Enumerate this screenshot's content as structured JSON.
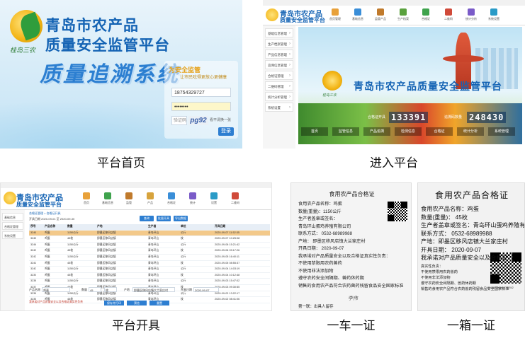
{
  "captions": {
    "home": "平台首页",
    "enter": "进入平台",
    "issue": "平台开具",
    "truck": "一车一证",
    "box": "一箱一证"
  },
  "login": {
    "title_line1": "青岛市农产品",
    "title_line2": "质量安全监管平台",
    "system_name": "质量追溯系统",
    "brand": "桂岛三农",
    "box_heading": "为安全监管",
    "box_sub": "让市民吃得更放心更健康",
    "username": "18754329727",
    "password": "••••••••",
    "captcha_placeholder": "验证码",
    "captcha_code": "pg92",
    "captcha_tip": "看不清换一张",
    "login_button": "登录"
  },
  "platform": {
    "title_line1": "青岛市农产品",
    "title_line2": "质量安全监管平台",
    "banner_title": "青岛市农产品质量安全监管平台",
    "brand": "桂岛三农",
    "nav": [
      "首页管理",
      "基础信息",
      "监管产品",
      "生产档案",
      "合格证",
      "二维码",
      "统计分析",
      "系统设置"
    ],
    "sidebar": [
      "基础信息管理",
      "生产档案管理",
      "产品信息管理",
      "追溯信息管理",
      "合格证管理",
      "二维码管理",
      "统计分析管理",
      "系统设置"
    ],
    "counter1_label": "合格证开具",
    "counter1": "133391",
    "counter2_label": "追溯码数量",
    "counter2": "248430",
    "tabs": [
      "首页",
      "监管信息",
      "产品追溯",
      "检测信息",
      "合格证",
      "统计分析",
      "系统管理"
    ]
  },
  "issue": {
    "title_line1": "青岛市农产品",
    "title_line2": "质量安全监管平台",
    "nav": [
      "首页",
      "基础信息",
      "监管",
      "产品",
      "合格证",
      "统计",
      "设置",
      "二维码"
    ],
    "sidebar": [
      "基础信息",
      "合格证管理",
      "系统设置"
    ],
    "crumb": "合格证管理 > 合格证开具",
    "filter": "开具日期 2020-09-01  至  2020-09-30",
    "buttons": [
      "查询",
      "批量开具",
      "导出数据"
    ],
    "headers": [
      "序号",
      "产品名称",
      "数量",
      "产地",
      "生产者",
      "单位",
      "开具日期"
    ],
    "rows": [
      [
        "3246",
        "鸡蛋",
        "1150公斤",
        "即墨区移风店镇",
        "青岛环山",
        "公斤",
        "2020-09-07 11:52:35"
      ],
      [
        "3245",
        "鸡蛋",
        "45枚",
        "即墨区移风店镇",
        "青岛环山",
        "枚",
        "2020-09-07 10:25:08"
      ],
      [
        "3244",
        "鸡蛋",
        "1150公斤",
        "即墨区移风店镇",
        "青岛环山",
        "公斤",
        "2020-09-06 15:21:42"
      ],
      [
        "3243",
        "鸡蛋",
        "45枚",
        "即墨区移风店镇",
        "青岛环山",
        "枚",
        "2020-09-06 09:17:26"
      ],
      [
        "3242",
        "鸡蛋",
        "1150公斤",
        "即墨区移风店镇",
        "青岛环山",
        "公斤",
        "2020-09-05 16:40:11"
      ],
      [
        "3241",
        "鸡蛋",
        "45枚",
        "即墨区移风店镇",
        "青岛环山",
        "枚",
        "2020-09-05 08:55:37"
      ],
      [
        "3240",
        "鸡蛋",
        "1150公斤",
        "即墨区移风店镇",
        "青岛环山",
        "公斤",
        "2020-09-04 14:03:19"
      ],
      [
        "3239",
        "鸡蛋",
        "45枚",
        "即墨区移风店镇",
        "青岛环山",
        "枚",
        "2020-09-04 10:12:48"
      ],
      [
        "3238",
        "鸡蛋",
        "1150公斤",
        "即墨区移风店镇",
        "青岛环山",
        "公斤",
        "2020-09-03 15:47:02"
      ],
      [
        "3237",
        "鸡蛋",
        "45枚",
        "即墨区移风店镇",
        "青岛环山",
        "枚",
        "2020-09-03 09:30:55"
      ],
      [
        "3236",
        "鸡蛋",
        "1150公斤",
        "即墨区移风店镇",
        "青岛环山",
        "公斤",
        "2020-09-02 13:22:17"
      ],
      [
        "3235",
        "鸡蛋",
        "45枚",
        "即墨区移风店镇",
        "青岛环山",
        "枚",
        "2020-09-02 08:41:06"
      ]
    ],
    "form": {
      "product_label": "产品名称",
      "product_value": "鸡蛋",
      "qty_label": "数量",
      "qty_value": "45",
      "unit_value": "枚",
      "place_label": "产地",
      "place_value": "即墨区移风店镇大兰家庄村",
      "date_label": "开具日期",
      "date_value": "2020-09-07"
    },
    "note": "我承诺对产品质量安全以及合格证真实性负责",
    "action_buttons": [
      "保存并打印",
      "预览",
      "重置"
    ]
  },
  "truck_cert": {
    "title": "食用农产品合格证",
    "lines": [
      "食用农产品名称：鸡蛋",
      "数量(重量)：1150公斤",
      "生产者盖章或签名：",
      "青岛环山蛋鸡养殖有限公司",
      "联系方式：  0532-68989988",
      "产地：   即墨区移风店镇大兰家庄村",
      "开具日期：  2020-09-07",
      "我承诺对产品质量安全以及合格证真实性负责：",
      "不使用禁限用农药兽药",
      "不使用非法添加物",
      "遵守农药安全间隔期、兽药休药期",
      "销售的食用农产品符合农药兽药残留食品安全国家标准"
    ],
    "signature": "李伟",
    "footer": "第一联：出具人留存"
  },
  "box_cert": {
    "title": "食用农产品合格证",
    "lines": [
      "食用农产品名称：鸡蛋",
      "数量(重量)：  45枚",
      "生产者盖章或签名：青岛环山蛋鸡养殖有限公司",
      "联系方式：  0532-68989988",
      "产地：即墨区移风店镇大兰家庄村",
      "开具日期：  2020-09-07",
      "我承诺对产品质量安全以及合格证"
    ],
    "small_lines": [
      "真实性负责：",
      "不使用禁限用农药兽药",
      "不使用非法添加物",
      "遵守农药安全间隔期、兽药休药期",
      "销售的食用农产品符合农药兽药残留食品安全国家标准"
    ],
    "code": "1240663604115707042"
  }
}
